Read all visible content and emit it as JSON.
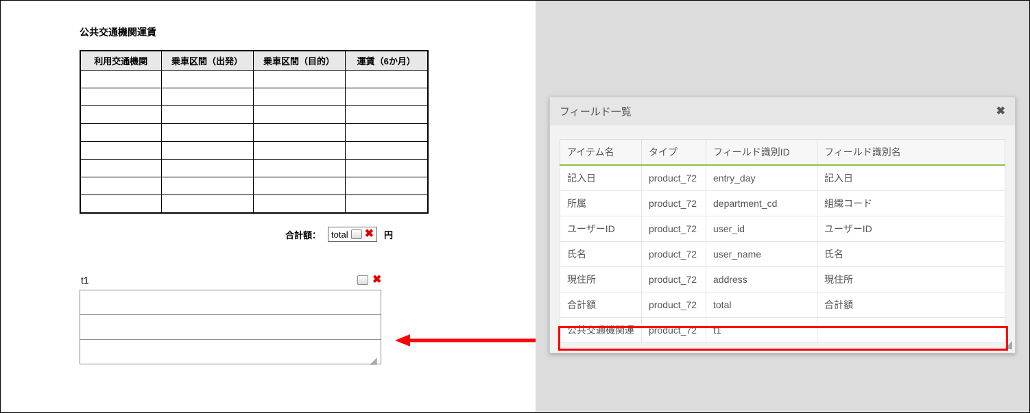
{
  "left": {
    "title": "公共交通機関運賃",
    "fare_headers": [
      "利用交通機関",
      "乗車区間（出発）",
      "乗車区間（目的）",
      "運賃（6か月）"
    ],
    "total_label": "合計額：",
    "total_field": "total",
    "total_unit": "円",
    "t1_label": "t1"
  },
  "dialog": {
    "title": "フィールド一覧",
    "headers": [
      "アイテム名",
      "タイプ",
      "フィールド識別ID",
      "フィールド識別名"
    ],
    "rows": [
      {
        "name": "記入日",
        "type": "product_72",
        "id": "entry_day",
        "label": "記入日"
      },
      {
        "name": "所属",
        "type": "product_72",
        "id": "department_cd",
        "label": "組織コード"
      },
      {
        "name": "ユーザーID",
        "type": "product_72",
        "id": "user_id",
        "label": "ユーザーID"
      },
      {
        "name": "氏名",
        "type": "product_72",
        "id": "user_name",
        "label": "氏名"
      },
      {
        "name": "現住所",
        "type": "product_72",
        "id": "address",
        "label": "現住所"
      },
      {
        "name": "合計額",
        "type": "product_72",
        "id": "total",
        "label": "合計額"
      },
      {
        "name": "公共交通機関運",
        "type": "product_72",
        "id": "t1",
        "label": ""
      }
    ]
  }
}
